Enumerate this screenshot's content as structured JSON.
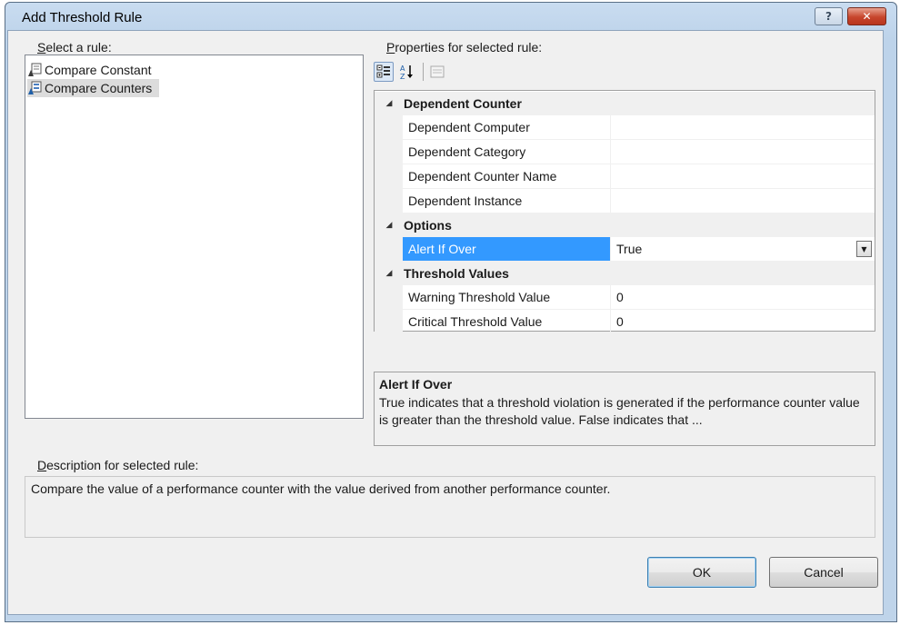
{
  "window": {
    "title": "Add Threshold Rule",
    "help_glyph": "?",
    "close_glyph": "✕"
  },
  "rules": {
    "label_accel": "S",
    "label_rest": "elect a rule:",
    "items": [
      {
        "label": "Compare Constant",
        "selected": false,
        "icon": "rule-constant-icon"
      },
      {
        "label": "Compare Counters",
        "selected": true,
        "icon": "rule-counters-icon"
      }
    ]
  },
  "properties": {
    "label_accel": "P",
    "label_rest": "roperties for selected rule:",
    "toolbar": {
      "categorized_icon": "categorized-view-icon",
      "alphabetical_icon": "alphabetical-sort-icon",
      "property_pages_icon": "property-pages-icon"
    },
    "categories": [
      {
        "name": "Dependent Counter",
        "rows": [
          {
            "name": "Dependent Computer",
            "value": ""
          },
          {
            "name": "Dependent Category",
            "value": ""
          },
          {
            "name": "Dependent Counter Name",
            "value": ""
          },
          {
            "name": "Dependent Instance",
            "value": ""
          }
        ]
      },
      {
        "name": "Options",
        "rows": [
          {
            "name": "Alert If Over",
            "value": "True",
            "selected": true
          }
        ]
      },
      {
        "name": "Threshold Values",
        "rows": [
          {
            "name": "Warning Threshold Value",
            "value": "0"
          },
          {
            "name": "Critical Threshold Value",
            "value": "0"
          }
        ]
      }
    ],
    "help": {
      "title": "Alert If Over",
      "text": "True indicates that a threshold violation is generated if the performance counter value is greater than the threshold value.  False indicates that ..."
    }
  },
  "description": {
    "label_accel": "D",
    "label_rest": "escription for selected rule:",
    "text": "Compare the value of a performance counter with the value derived from another performance counter."
  },
  "buttons": {
    "ok": "OK",
    "cancel": "Cancel"
  },
  "colors": {
    "selection": "#3399ff",
    "title_bar": "#bfd4ea",
    "close_button": "#c7452c"
  }
}
